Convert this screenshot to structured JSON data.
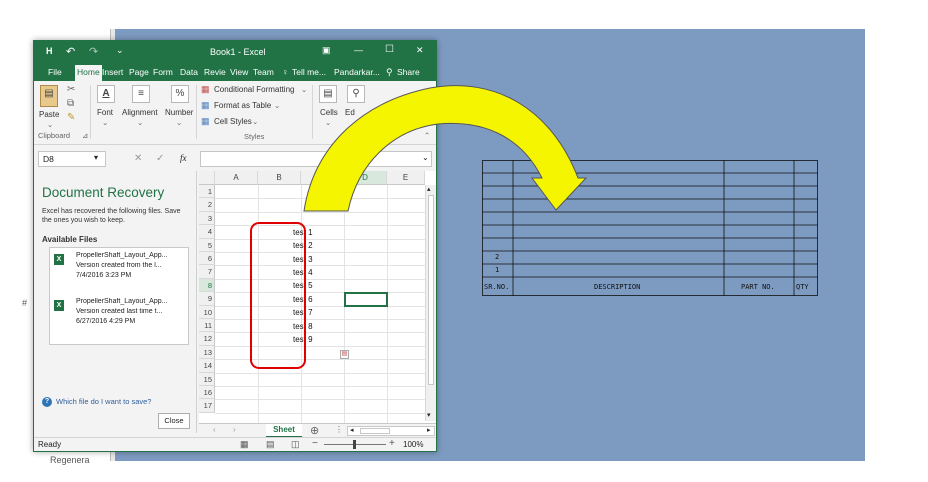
{
  "excel": {
    "title": "Book1 - Excel",
    "quick_access": {
      "save": "H",
      "undo": "↶",
      "redo": "↷",
      "customize": "⌄"
    },
    "window_buttons": {
      "ribbon_options": "▣",
      "minimize": "—",
      "maximize": "☐",
      "close": "✕"
    },
    "tabs": [
      "File",
      "Home",
      "Insert",
      "Page",
      "Form",
      "Data",
      "Revie",
      "View",
      "Team"
    ],
    "tell_me": "Tell me...",
    "user": "Pandarkar...",
    "share": "Share",
    "ribbon": {
      "paste": "Paste",
      "clipboard": "Clipboard",
      "font": "Font",
      "alignment": "Alignment",
      "number": "Number",
      "conditional_formatting": "Conditional Formatting",
      "format_as_table": "Format as Table",
      "cell_styles": "Cell Styles",
      "styles": "Styles",
      "cells": "Cells",
      "editing": "Ed"
    },
    "name_box": "D8",
    "fx_label": "fx",
    "recovery": {
      "title": "Document Recovery",
      "description": "Excel has recovered the following files. Save the ones you wish to keep.",
      "available_files": "Available Files",
      "files": [
        {
          "name": "PropellerShaft_Layout_App...",
          "version": "Version created from the l...",
          "date": "7/4/2016 3:23 PM"
        },
        {
          "name": "PropellerShaft_Layout_App...",
          "version": "Version created last time t...",
          "date": "6/27/2016 4:29 PM"
        }
      ],
      "help": "Which file do I want to save?",
      "close": "Close"
    },
    "columns": [
      "A",
      "B",
      "C",
      "D",
      "E"
    ],
    "rows": [
      "1",
      "2",
      "3",
      "4",
      "5",
      "6",
      "7",
      "8",
      "9",
      "10",
      "11",
      "12",
      "13",
      "14",
      "15",
      "16",
      "17"
    ],
    "cells_b": [
      "test 1",
      "test 2",
      "test 3",
      "test 4",
      "test 5",
      "test 6",
      "test 7",
      "test 8",
      "test 9"
    ],
    "sheet_tab": "Sheet",
    "status": "Ready",
    "zoom": "100%"
  },
  "cad_bom": {
    "rows_numbers": [
      "2",
      "1"
    ],
    "headers": [
      "SR.NO.",
      "DESCRIPTION",
      "PART NO.",
      "QTY"
    ]
  },
  "background": {
    "left_glyph": "#",
    "bottom_text": "Regenera"
  },
  "colors": {
    "excel_green": "#217346",
    "highlight_red": "#e00000",
    "arrow_yellow": "#f5f500",
    "cad_blue": "#7d9bc1"
  }
}
